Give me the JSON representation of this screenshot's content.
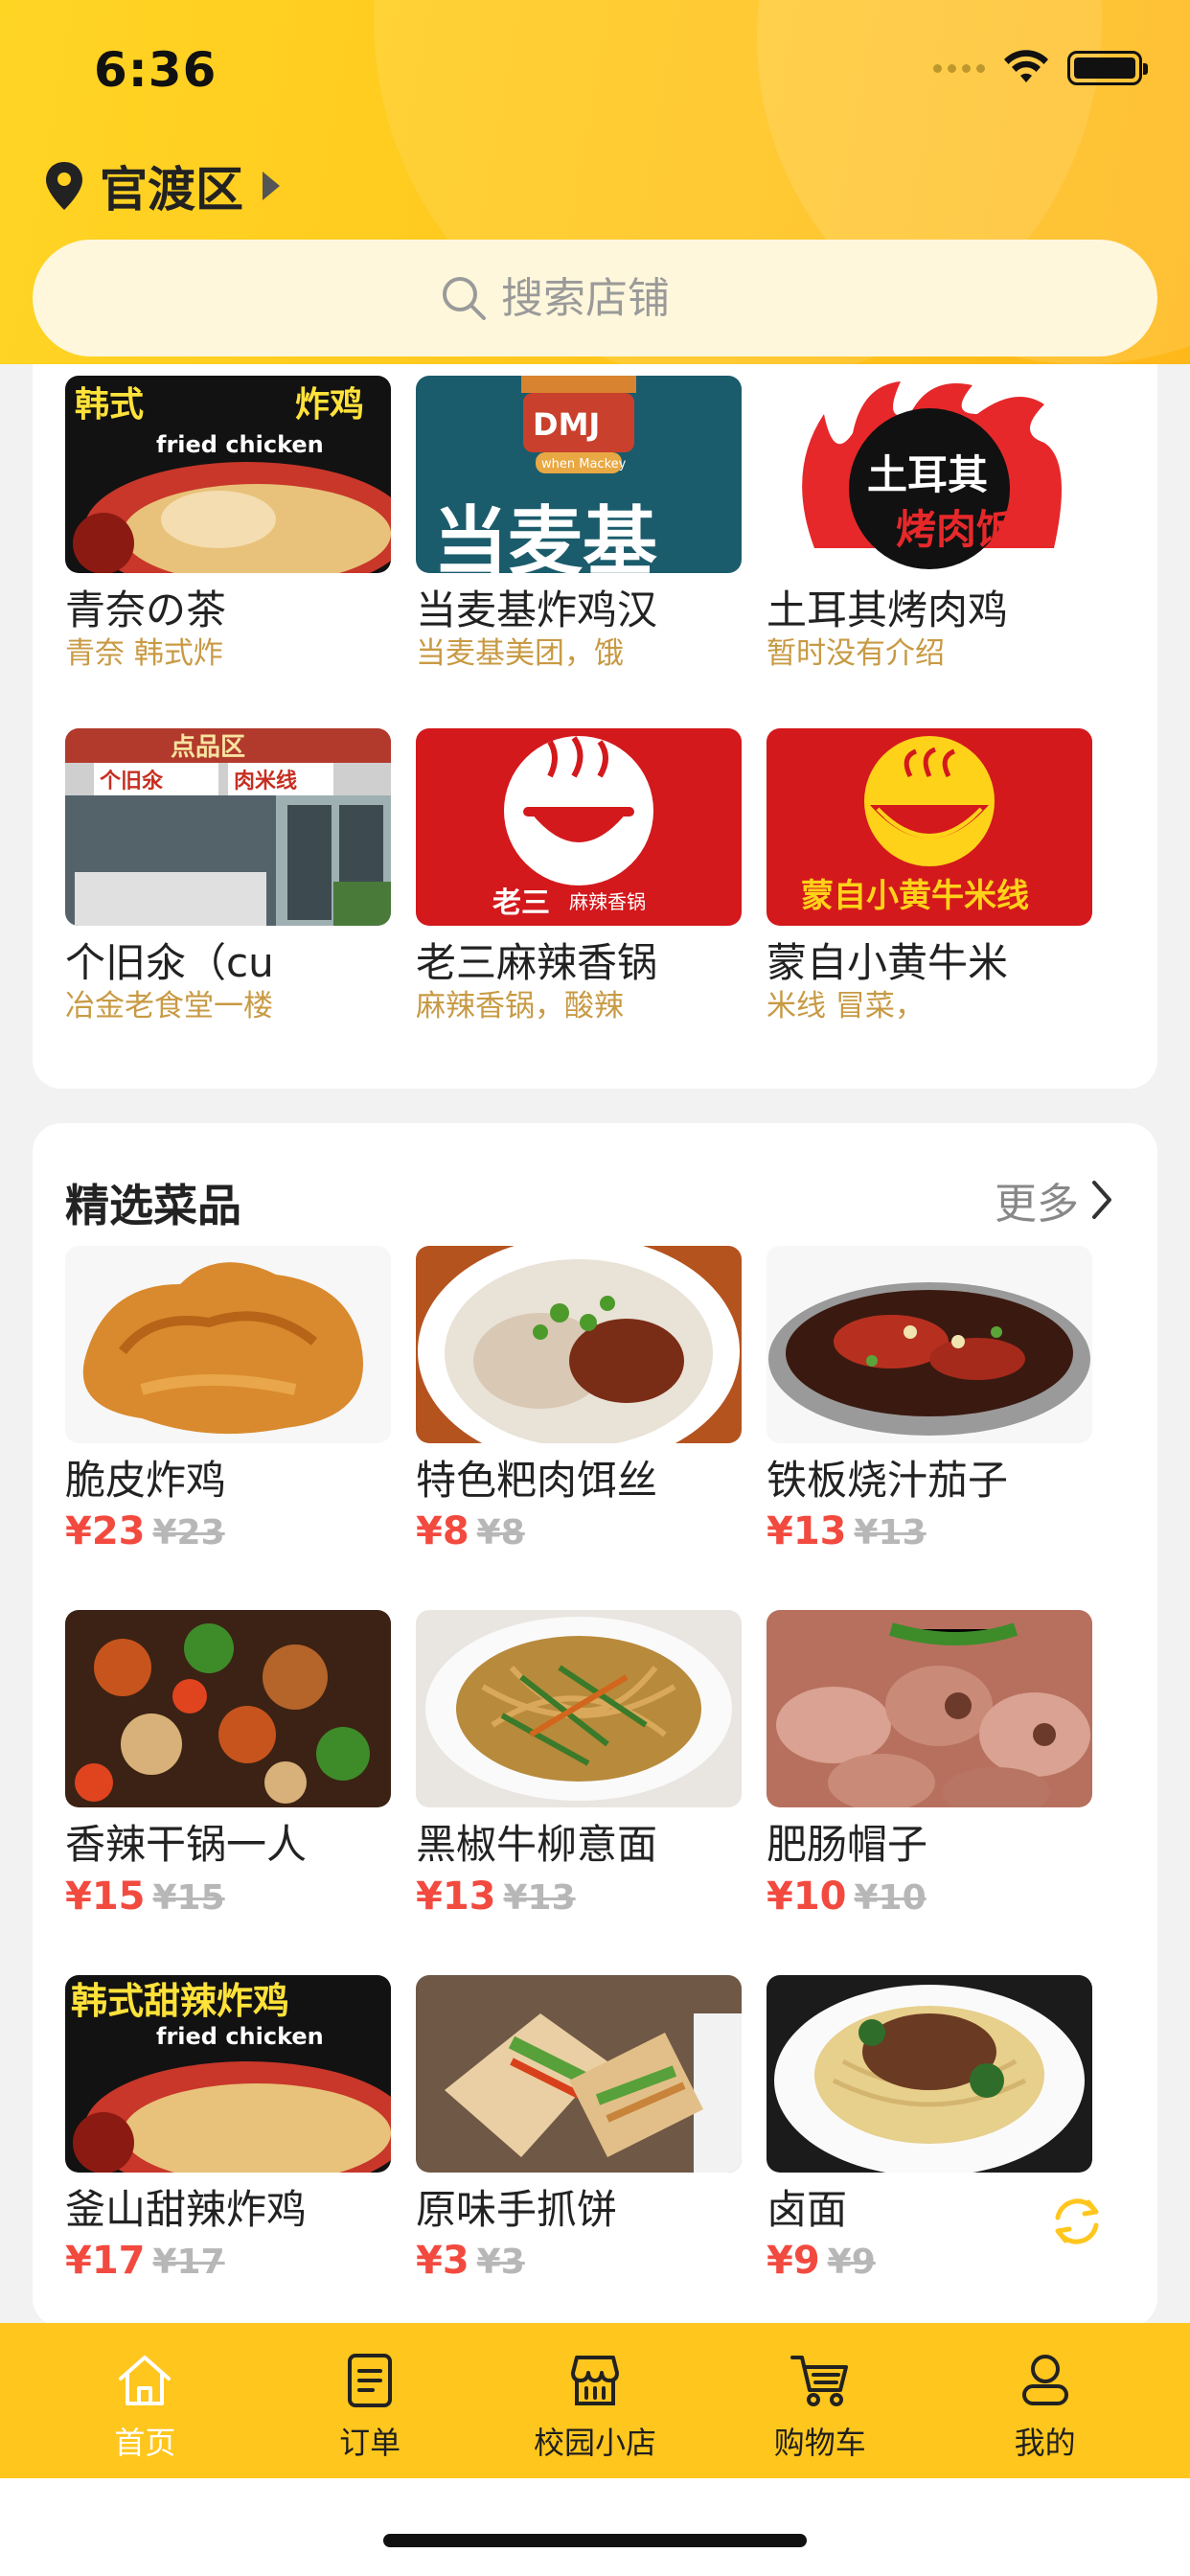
{
  "status_bar": {
    "time": "6:36"
  },
  "header": {
    "location": "官渡区",
    "search_placeholder": "搜索店铺"
  },
  "shops": [
    {
      "name": "青奈の茶",
      "desc": "青奈  韩式炸",
      "image": "fried-chicken-photo",
      "banner_top": "韩式",
      "banner_top2": "炸鸡",
      "banner_sub": "fried chicken"
    },
    {
      "name": "当麦基炸鸡汉",
      "desc": "当麦基美团，饿",
      "image": "dmj-logo",
      "logo_text": "DMJ",
      "logo_sub": "when Mackey",
      "banner": "当麦基"
    },
    {
      "name": "土耳其烤肉鸡",
      "desc": "暂时没有介绍",
      "image": "kebab-logo",
      "logo_top": "土耳其",
      "logo_bottom": "烤肉饭"
    },
    {
      "name": "个旧氽（cu",
      "desc": "冶金老食堂一楼",
      "image": "storefront-photo",
      "sign_top": "点品区",
      "sign_left": "个旧氽",
      "sign_right": "肉米线"
    },
    {
      "name": "老三麻辣香锅",
      "desc": "麻辣香锅，酸辣",
      "image": "hotpot-logo",
      "logo_text": "老三",
      "logo_sub": "麻辣香锅"
    },
    {
      "name": "蒙自小黄牛米",
      "desc": "米线  冒菜，",
      "image": "noodle-logo",
      "logo_text": "蒙自小黄牛米线"
    }
  ],
  "featured": {
    "title": "精选菜品",
    "more": "更多",
    "dishes": [
      {
        "name": "脆皮炸鸡",
        "price": "¥23",
        "old_price": "¥23",
        "image": "fried-chicken"
      },
      {
        "name": "特色粑肉饵丝",
        "price": "¥8",
        "old_price": "¥8",
        "image": "rice-noodle-soup"
      },
      {
        "name": "铁板烧汁茄子",
        "price": "¥13",
        "old_price": "¥13",
        "image": "teppan-eggplant"
      },
      {
        "name": "香辣干锅一人",
        "price": "¥15",
        "old_price": "¥15",
        "image": "dry-pot"
      },
      {
        "name": "黑椒牛柳意面",
        "price": "¥13",
        "old_price": "¥13",
        "image": "beef-pasta"
      },
      {
        "name": "肥肠帽子",
        "price": "¥10",
        "old_price": "¥10",
        "image": "pork-intestine"
      },
      {
        "name": "釜山甜辣炸鸡",
        "price": "¥17",
        "old_price": "¥17",
        "image": "sweet-spicy-chicken",
        "banner_top": "韩式甜辣炸鸡",
        "banner_sub": "fried chicken"
      },
      {
        "name": "原味手抓饼",
        "price": "¥3",
        "old_price": "¥3",
        "image": "hand-pancake-wrap"
      },
      {
        "name": "卤面",
        "price": "¥9",
        "old_price": "¥9",
        "image": "braised-noodles"
      }
    ]
  },
  "tabbar": [
    {
      "label": "首页",
      "icon": "home-icon",
      "active": true
    },
    {
      "label": "订单",
      "icon": "order-icon",
      "active": false
    },
    {
      "label": "校园小店",
      "icon": "store-icon",
      "active": false
    },
    {
      "label": "购物车",
      "icon": "cart-icon",
      "active": false
    },
    {
      "label": "我的",
      "icon": "profile-icon",
      "active": false
    }
  ],
  "colors": {
    "accent": "#ffc61d",
    "price": "#f24a3f",
    "desc": "#c89a44"
  }
}
